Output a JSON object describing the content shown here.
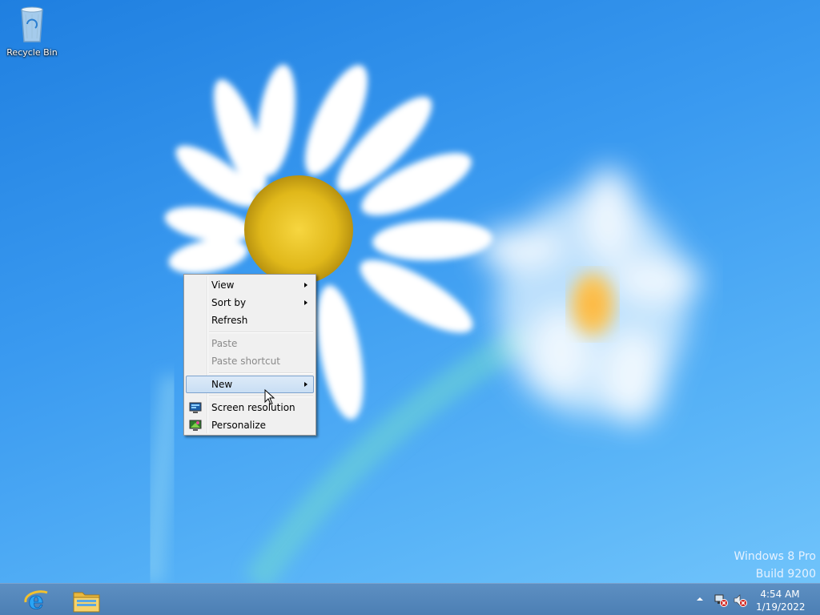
{
  "desktop": {
    "icons": [
      {
        "label": "Recycle Bin",
        "icon": "recycle-bin-icon"
      }
    ],
    "watermark": {
      "line1": "Windows 8 Pro",
      "line2": "Build 9200"
    }
  },
  "context_menu": {
    "items": [
      {
        "label": "View",
        "submenu": true,
        "enabled": true
      },
      {
        "label": "Sort by",
        "submenu": true,
        "enabled": true
      },
      {
        "label": "Refresh",
        "submenu": false,
        "enabled": true
      },
      {
        "label": "Paste",
        "submenu": false,
        "enabled": false
      },
      {
        "label": "Paste shortcut",
        "submenu": false,
        "enabled": false
      },
      {
        "label": "New",
        "submenu": true,
        "enabled": true,
        "highlighted": true
      },
      {
        "label": "Screen resolution",
        "icon": "display-settings-icon",
        "enabled": true
      },
      {
        "label": "Personalize",
        "icon": "personalize-icon",
        "enabled": true
      }
    ]
  },
  "taskbar": {
    "pinned": [
      {
        "name": "Internet Explorer",
        "icon": "internet-explorer-icon"
      },
      {
        "name": "File Explorer",
        "icon": "file-explorer-icon"
      }
    ],
    "tray": {
      "icons": [
        "show-hidden-icons-arrow",
        "network-disconnected-icon",
        "volume-muted-icon"
      ],
      "time": "4:54 AM",
      "date": "1/19/2022"
    }
  },
  "colors": {
    "accent": "#3a9af0",
    "taskbar": "#5287bc",
    "menu_highlight": "#c9def4"
  }
}
